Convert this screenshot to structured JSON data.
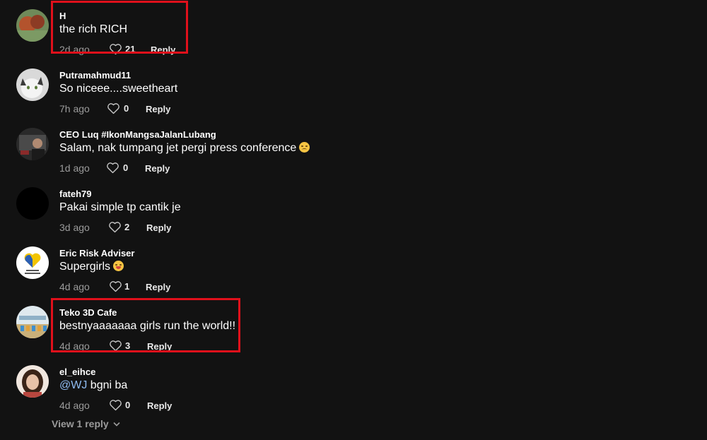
{
  "comments": [
    {
      "username": "H",
      "text": "the rich RICH",
      "time": "2d ago",
      "likes": "21",
      "reply_label": "Reply"
    },
    {
      "username": "Putramahmud11",
      "text": "So niceee....sweetheart",
      "time": "7h ago",
      "likes": "0",
      "reply_label": "Reply"
    },
    {
      "username": "CEO Luq #IkonMangsaJalanLubang",
      "text": "Salam, nak tumpang jet pergi press conference",
      "emoji": "disappointed-face",
      "time": "1d ago",
      "likes": "0",
      "reply_label": "Reply"
    },
    {
      "username": "fateh79",
      "text": "Pakai simple tp cantik je",
      "time": "3d ago",
      "likes": "2",
      "reply_label": "Reply"
    },
    {
      "username": "Eric Risk Adviser",
      "text": "Supergirls",
      "emoji": "zany-face",
      "time": "4d ago",
      "likes": "1",
      "reply_label": "Reply"
    },
    {
      "username": "Teko 3D Cafe",
      "text": "bestnyaaaaaaa girls run the world!!",
      "time": "4d ago",
      "likes": "3",
      "reply_label": "Reply"
    },
    {
      "username": "el_eihce",
      "mention": "@WJ",
      "text": "bgni ba",
      "time": "4d ago",
      "likes": "0",
      "reply_label": "Reply"
    }
  ],
  "view_replies": "View 1 reply",
  "icons": {
    "like": "heart-outline-icon",
    "expand": "chevron-down-icon"
  },
  "colors": {
    "background": "#121212",
    "highlight": "#e0101b",
    "mention": "#8fbcf2",
    "muted": "#9b9b9b"
  }
}
